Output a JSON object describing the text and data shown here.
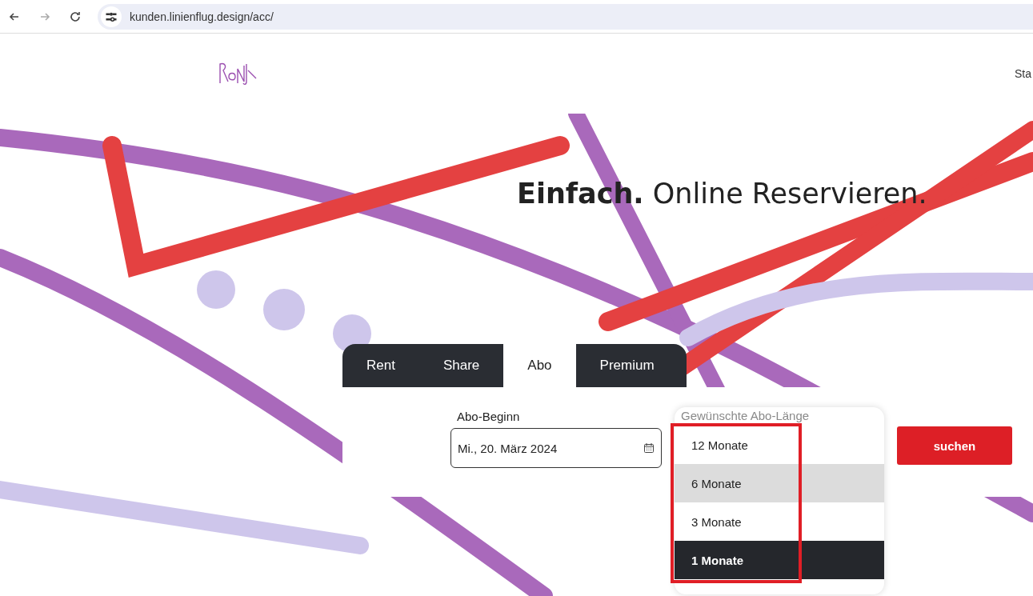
{
  "browser": {
    "url": "kunden.linienflug.design/acc/"
  },
  "header": {
    "nav_item": "Sta"
  },
  "hero": {
    "headline": "**Einfach.** Online Reservieren."
  },
  "tabs": [
    {
      "label": "Rent",
      "selected": false
    },
    {
      "label": "Share",
      "selected": false
    },
    {
      "label": "Abo",
      "selected": true
    },
    {
      "label": "Premium",
      "selected": false
    }
  ],
  "form": {
    "start_label": "Abo-Beginn",
    "start_value": "Mi., 20. März 2024",
    "length_label": "Gewünschte Abo-Länge",
    "length_options": [
      {
        "label": "12 Monate",
        "selected": false,
        "hovered": false
      },
      {
        "label": "6 Monate",
        "selected": false,
        "hovered": true
      },
      {
        "label": "3 Monate",
        "selected": false,
        "hovered": false
      },
      {
        "label": "1 Monate",
        "selected": true,
        "hovered": false
      }
    ],
    "search_button": "suchen",
    "highlight": true
  }
}
